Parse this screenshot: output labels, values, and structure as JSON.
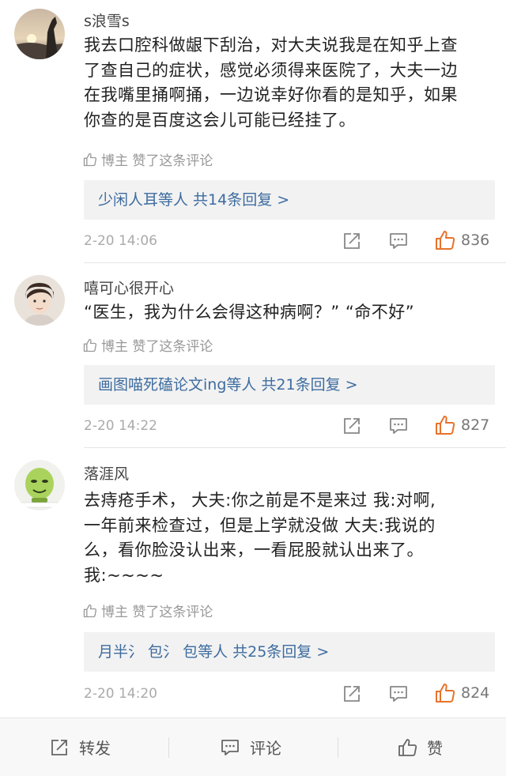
{
  "colors": {
    "link": "#3d6ca0",
    "like_active": "#e8722a",
    "muted": "#999999"
  },
  "comments": [
    {
      "username": "s浪雪s",
      "lines": [
        "我去口腔科做龈下刮治，对大夫说我是在知乎上查",
        "了查自己的症状，感觉必须得来医院了，大夫一边",
        "在我嘴里捅啊捅，一边说幸好你看的是知乎，如果",
        "你查的是百度这会儿可能已经挂了。"
      ],
      "liked_by": "博主 赞了这条评论",
      "replies": "少闲人耳等人  共14条回复 >",
      "time": "2-20 14:06",
      "likes": "836"
    },
    {
      "username": "嘻可心很开心",
      "lines": [
        "“医生，我为什么会得这种病啊？” “命不好”"
      ],
      "liked_by": "博主 赞了这条评论",
      "replies": "画图喵死磕论文ing等人  共21条回复 >",
      "time": "2-20 14:22",
      "likes": "827"
    },
    {
      "username": "落涯风",
      "lines": [
        "去痔疮手术，  大夫:你之前是不是来过 我:对啊,",
        "一年前来检查过，但是上学就没做 大夫:我说的",
        "么，看你脸没认出来，一看屁股就认出来了。",
        "我:~~~~"
      ],
      "liked_by": "博主 赞了这条评论",
      "replies": "月半氵 包氵 包等人  共25条回复 >",
      "time": "2-20 14:20",
      "likes": "824"
    }
  ],
  "bottom_bar": {
    "repost": "转发",
    "comment": "评论",
    "like": "赞"
  }
}
